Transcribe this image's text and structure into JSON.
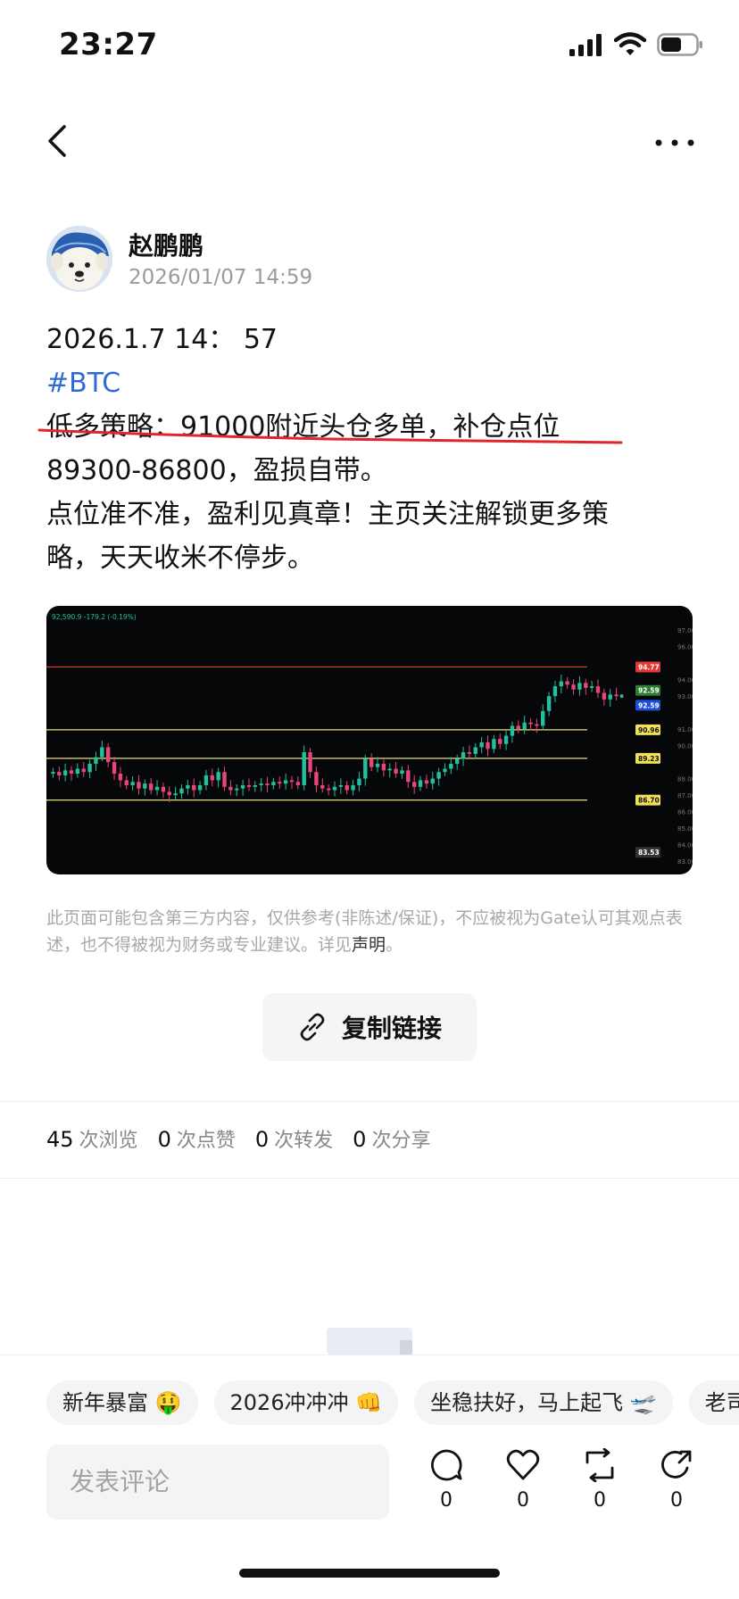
{
  "status_bar": {
    "time": "23:27"
  },
  "post": {
    "author": "赵鹏鹏",
    "timestamp": "2026/01/07 14:59",
    "lines": [
      "2026.1.7 14： 57",
      "#BTC",
      "低多策略：91000附近头仓多单，补仓点位",
      "89300-86800，盈损自带。",
      "点位准不准，盈利见真章！主页关注解锁更多策",
      "略，天天收米不停步。"
    ]
  },
  "chart_data": {
    "type": "candlestick",
    "header_readout": "92,590.9 -179.2 (-0.19%)",
    "y_axis_ticks": [
      "97.00",
      "96.00",
      "94.00",
      "93.00",
      "91.00",
      "90.00",
      "88.00",
      "87.00",
      "86.00",
      "85.00",
      "84.00",
      "83.00"
    ],
    "price_labels": [
      {
        "text": "94.77",
        "color": "#e53935"
      },
      {
        "text": "92.59",
        "color": "#2e7d32"
      },
      {
        "text": "92.59",
        "color": "#1e4fd8"
      },
      {
        "text": "90.96",
        "color": "#f1e05a"
      },
      {
        "text": "89.23",
        "color": "#f1e05a"
      },
      {
        "text": "86.70",
        "color": "#f1e05a"
      },
      {
        "text": "83.53",
        "color": "#333333"
      }
    ],
    "horizontal_levels": [
      {
        "value": 94.77,
        "color": "#e53935"
      },
      {
        "value": 90.96,
        "color": "#e8e07a"
      },
      {
        "value": 89.23,
        "color": "#e8e07a"
      },
      {
        "value": 86.7,
        "color": "#e8e07a"
      }
    ],
    "ylim": [
      83.0,
      97.5
    ],
    "up_color": "#22c0a0",
    "down_color": "#e8457a",
    "closes": [
      88.4,
      88.2,
      88.5,
      88.3,
      88.6,
      88.4,
      88.9,
      89.3,
      89.9,
      89.0,
      88.3,
      87.9,
      87.6,
      87.8,
      87.4,
      87.7,
      87.3,
      87.5,
      87.2,
      87.0,
      87.1,
      87.4,
      87.6,
      87.3,
      87.6,
      88.2,
      87.9,
      88.4,
      87.5,
      87.3,
      87.4,
      87.6,
      87.5,
      87.6,
      87.7,
      87.6,
      87.8,
      87.7,
      87.9,
      87.8,
      87.6,
      89.6,
      88.4,
      87.6,
      87.4,
      87.3,
      87.5,
      87.6,
      87.3,
      87.6,
      88.0,
      89.2,
      88.7,
      88.9,
      88.5,
      88.6,
      88.3,
      88.5,
      87.8,
      87.5,
      87.9,
      87.7,
      88.0,
      88.4,
      88.6,
      88.9,
      89.2,
      89.6,
      89.5,
      89.9,
      90.2,
      89.8,
      90.4,
      90.1,
      90.6,
      91.2,
      91.0,
      91.4,
      91.3,
      91.2,
      92.1,
      93.0,
      93.6,
      93.9,
      93.7,
      93.4,
      93.8,
      93.5,
      93.6,
      93.2,
      92.8,
      93.1,
      93.0
    ]
  },
  "disclaimer": {
    "text": "此页面可能包含第三方内容，仅供参考(非陈述/保证)，不应被视为Gate认可其观点表述，也不得被视为财务或专业建议。详见",
    "link": "声明",
    "end": "。"
  },
  "copy_link": {
    "label": "复制链接"
  },
  "stats": [
    {
      "count": "45",
      "label": "次浏览"
    },
    {
      "count": "0",
      "label": "次点赞"
    },
    {
      "count": "0",
      "label": "次转发"
    },
    {
      "count": "0",
      "label": "次分享"
    }
  ],
  "chips": [
    "新年暴富 🤑",
    "2026冲冲冲 👊",
    "坐稳扶好，马上起飞 🛫",
    "老司"
  ],
  "comment": {
    "placeholder": "发表评论"
  },
  "actions": [
    {
      "icon": "comment-icon",
      "count": "0"
    },
    {
      "icon": "like-icon",
      "count": "0"
    },
    {
      "icon": "repost-icon",
      "count": "0"
    },
    {
      "icon": "share-icon",
      "count": "0"
    }
  ]
}
